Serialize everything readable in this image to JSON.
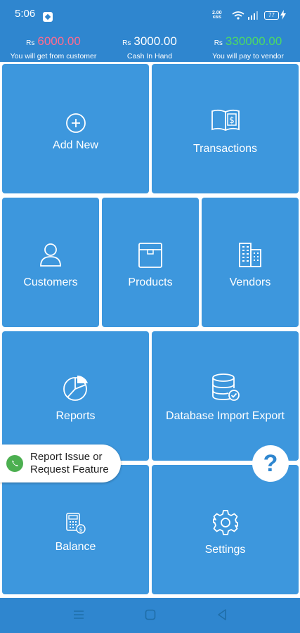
{
  "status_bar": {
    "time": "5:06",
    "speed_top": "2.00",
    "speed_bottom": "KB/S",
    "battery": "77"
  },
  "summary": {
    "currency": "Rs",
    "receivable_amount": "6000.00",
    "receivable_caption": "You will get from customer",
    "cash_amount": "3000.00",
    "cash_caption": "Cash In Hand",
    "payable_amount": "330000.00",
    "payable_caption": "You will pay to vendor"
  },
  "tiles": {
    "add_new": "Add New",
    "transactions": "Transactions",
    "customers": "Customers",
    "products": "Products",
    "vendors": "Vendors",
    "reports": "Reports",
    "database": "Database Import Export",
    "balance": "Balance",
    "settings": "Settings"
  },
  "report_bubble": {
    "line1": "Report Issue or",
    "line2": "Request Feature"
  },
  "help_label": "?",
  "colors": {
    "header": "#2f86cf",
    "tile": "#3d97dd",
    "receivable": "#ff6b8f",
    "payable": "#4cd964"
  },
  "icons": [
    "plus-circle-icon",
    "ledger-book-icon",
    "user-icon",
    "box-icon",
    "building-icon",
    "pie-chart-icon",
    "database-check-icon",
    "calculator-icon",
    "gear-icon",
    "whatsapp-icon"
  ]
}
